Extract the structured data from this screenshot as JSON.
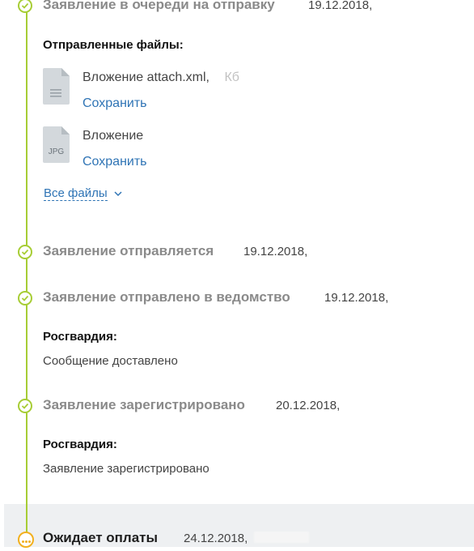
{
  "colors": {
    "timeline": "#a7cd35",
    "pending": "#f2b01e",
    "link": "#2f74b5",
    "title_gray": "#8a8a8a",
    "footer_bg": "#eef0f2"
  },
  "statuses": [
    {
      "title": "Заявление в очереди на отправку",
      "date": "19.12.2018,",
      "files_label": "Отправленные файлы:",
      "files": [
        {
          "icon": "xml-file-icon",
          "name": "Вложение attach.xml,",
          "size": "Кб",
          "save_label": "Сохранить"
        },
        {
          "icon": "jpg-file-icon",
          "type_label": "JPG",
          "name": "Вложение",
          "save_label": "Сохранить"
        }
      ],
      "all_files_label": "Все файлы"
    },
    {
      "title": "Заявление отправляется",
      "date": "19.12.2018,"
    },
    {
      "title": "Заявление отправлено в ведомство",
      "date": "19.12.2018,",
      "org_label": "Росгвардия:",
      "message": "Сообщение доставлено"
    },
    {
      "title": "Заявление зарегистрировано",
      "date": "20.12.2018,",
      "org_label": "Росгвардия:",
      "message": "Заявление зарегистрировано"
    },
    {
      "title": "Ожидает оплаты",
      "date": "24.12.2018,",
      "state": "pending"
    }
  ]
}
